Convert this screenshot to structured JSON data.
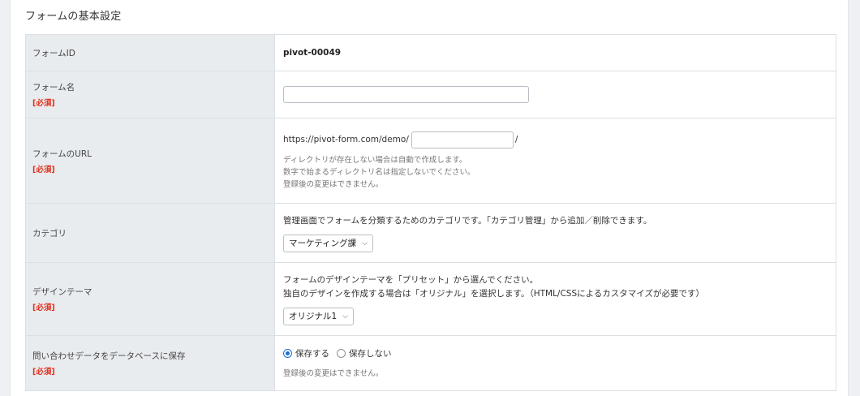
{
  "section_title": "フォームの基本設定",
  "rows": {
    "form_id": {
      "label": "フォームID",
      "value": "pivot-00049"
    },
    "form_name": {
      "label": "フォーム名",
      "required": "[必須]",
      "value": ""
    },
    "form_url": {
      "label": "フォームのURL",
      "required": "[必須]",
      "prefix": "https://pivot-form.com/demo/",
      "value": "",
      "suffix": "/",
      "help": [
        "ディレクトリが存在しない場合は自動で作成します。",
        "数字で始まるディレクトリ名は指定しないでください。",
        "登録後の変更はできません。"
      ]
    },
    "category": {
      "label": "カテゴリ",
      "description": "管理画面でフォームを分類するためのカテゴリです。「カテゴリ管理」から追加／削除できます。",
      "selected": "マーケティング課"
    },
    "design_theme": {
      "label": "デザインテーマ",
      "required": "[必須]",
      "description": [
        "フォームのデザインテーマを「プリセット」から選んでください。",
        "独自のデザインを作成する場合は「オリジナル」を選択します。（HTML/CSSによるカスタマイズが必要です）"
      ],
      "selected": "オリジナル1"
    },
    "save_db": {
      "label": "問い合わせデータをデータベースに保存",
      "required": "[必須]",
      "options": [
        "保存する",
        "保存しない"
      ],
      "selected_index": 0,
      "help": "登録後の変更はできません。"
    }
  },
  "icons": {
    "select_chevron": "chevron-down-icon"
  },
  "colors": {
    "required": "#e0301e",
    "accent": "#1a6fd6",
    "label_bg": "#e9ecef"
  }
}
